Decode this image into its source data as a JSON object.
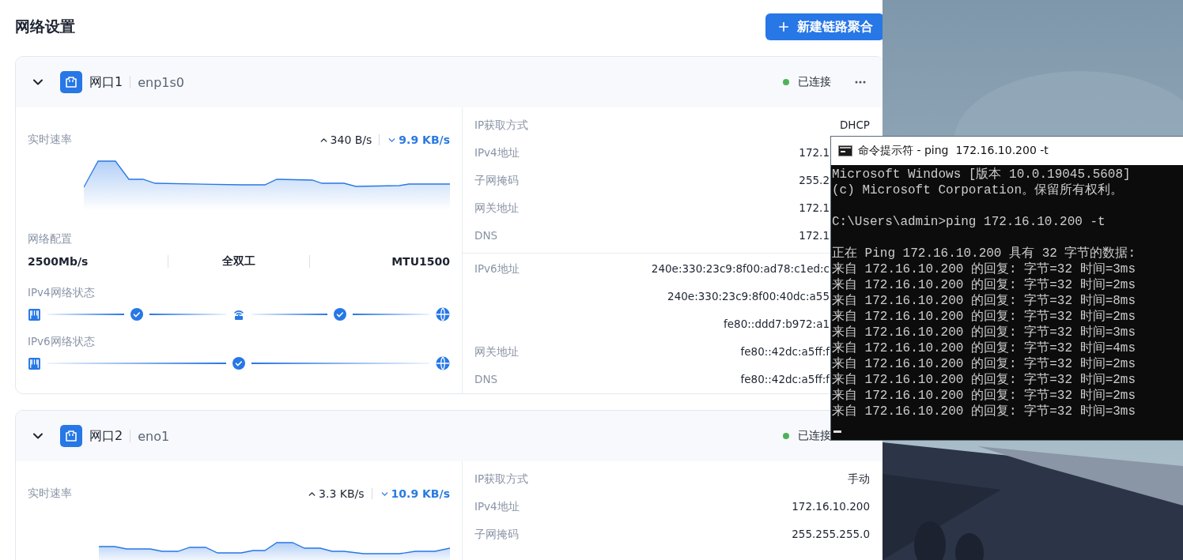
{
  "page_title": "网络设置",
  "new_button": {
    "label": "新建链路聚合"
  },
  "ports": [
    {
      "name": "网口1",
      "device": "enp1s0",
      "expanded": true,
      "status": "已连接",
      "speed": {
        "label": "实时速率",
        "up": "340 B/s",
        "down": "9.9 KB/s"
      },
      "config": {
        "label": "网络配置",
        "values": [
          "2500Mb/s",
          "全双工",
          "MTU1500"
        ]
      },
      "status_rows": [
        {
          "label": "IPv4网络状态",
          "nodes": [
            {
              "kind": "port"
            },
            {
              "kind": "ok"
            },
            {
              "kind": "router"
            },
            {
              "kind": "ok"
            },
            {
              "kind": "internet"
            }
          ]
        },
        {
          "label": "IPv6网络状态",
          "nodes": [
            {
              "kind": "port"
            },
            {
              "kind": "ok"
            },
            {
              "kind": "internet"
            }
          ]
        }
      ],
      "ipv4": [
        {
          "label": "IP获取方式",
          "values": [
            "DHCP"
          ],
          "covered": false
        },
        {
          "label": "IPv4地址",
          "values": [
            "172.1"
          ],
          "covered": true
        },
        {
          "label": "子网掩码",
          "values": [
            "255.2"
          ],
          "covered": true
        },
        {
          "label": "网关地址",
          "values": [
            "172.1"
          ],
          "covered": true
        },
        {
          "label": "DNS",
          "values": [
            "172.1"
          ],
          "covered": true
        }
      ],
      "ipv6": [
        {
          "label": "IPv6地址",
          "values": [
            "240e:330:23c9:8f00:ad78:c1ed:c",
            "240e:330:23c9:8f00:40dc:a55",
            "fe80::ddd7:b972:a1"
          ],
          "covered": true
        },
        {
          "label": "网关地址",
          "values": [
            "fe80::42dc:a5ff:f"
          ],
          "covered": true
        },
        {
          "label": "DNS",
          "values": [
            "fe80::42dc:a5ff:f"
          ],
          "covered": true
        }
      ]
    },
    {
      "name": "网口2",
      "device": "eno1",
      "expanded": true,
      "status": "已连接",
      "speed": {
        "label": "实时速率",
        "up": "3.3 KB/s",
        "down": "10.9 KB/s"
      },
      "ipv4": [
        {
          "label": "IP获取方式",
          "values": [
            "手动"
          ],
          "covered": false
        },
        {
          "label": "IPv4地址",
          "values": [
            "172.16.10.200"
          ],
          "covered": false
        },
        {
          "label": "子网掩码",
          "values": [
            "255.255.255.0"
          ],
          "covered": false
        }
      ]
    }
  ],
  "cmd_window": {
    "title": "命令提示符 - ping  172.16.10.200 -t",
    "blocks": [
      [
        "Microsoft Windows [版本 10.0.19045.5608]",
        "(c) Microsoft Corporation。保留所有权利。"
      ],
      [
        "C:\\Users\\admin>ping 172.16.10.200 -t"
      ],
      [
        "正在 Ping 172.16.10.200 具有 32 字节的数据:",
        "来自 172.16.10.200 的回复: 字节=32 时间=3ms",
        "来自 172.16.10.200 的回复: 字节=32 时间=2ms",
        "来自 172.16.10.200 的回复: 字节=32 时间=8ms",
        "来自 172.16.10.200 的回复: 字节=32 时间=2ms",
        "来自 172.16.10.200 的回复: 字节=32 时间=3ms",
        "来自 172.16.10.200 的回复: 字节=32 时间=4ms",
        "来自 172.16.10.200 的回复: 字节=32 时间=2ms",
        "来自 172.16.10.200 的回复: 字节=32 时间=2ms",
        "来自 172.16.10.200 的回复: 字节=32 时间=2ms",
        "来自 172.16.10.200 的回复: 字节=32 时间=3ms"
      ]
    ]
  }
}
